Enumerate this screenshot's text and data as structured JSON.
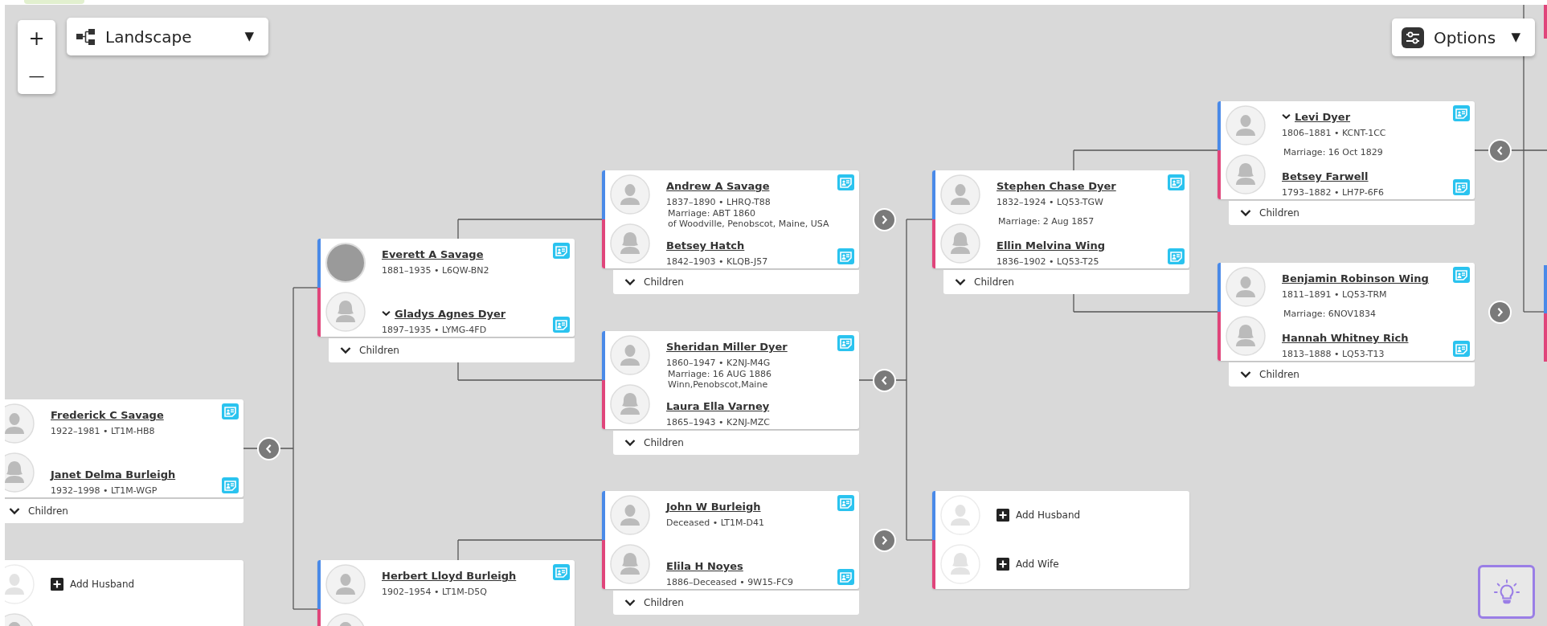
{
  "controls": {
    "zoom_in": "+",
    "zoom_out": "—",
    "layout_menu": {
      "label": "Landscape",
      "caret": "▼"
    },
    "options_menu": {
      "label": "Options",
      "caret": "▼"
    }
  },
  "couples": [
    {
      "husband": {
        "kind": "person",
        "name": "Frederick C Savage",
        "details": "1922–1981 • LT1M-HB8",
        "record": true,
        "toggle": false,
        "photo": false
      },
      "wife": {
        "kind": "person",
        "name": "Janet Delma Burleigh",
        "details": "1932–1998 • LT1M-WGP",
        "record": true,
        "toggle": false,
        "photo": false
      },
      "children_label": "Children",
      "ancestors_shown": true
    },
    {
      "husband": {
        "kind": "add",
        "label": "Add Husband"
      }
    },
    {
      "husband": {
        "kind": "person",
        "name": "Everett A Savage",
        "details": "1881–1935 • L6QW-BN2",
        "record": true,
        "toggle": false,
        "photo": true
      },
      "wife": {
        "kind": "person",
        "name": "Gladys Agnes Dyer",
        "details": "1897–1935 • LYMG-4FD",
        "record": true,
        "toggle": true,
        "photo": false
      },
      "children_label": "Children"
    },
    {
      "husband": {
        "kind": "person",
        "name": "Herbert Lloyd Burleigh",
        "details": "1902–1954 • LT1M-D5Q",
        "record": true,
        "toggle": false,
        "photo": false
      }
    },
    {
      "husband": {
        "kind": "person",
        "name": "Andrew A Savage",
        "details": "1837–1890 • LHRQ-T88",
        "record": true,
        "toggle": false,
        "photo": false
      },
      "wife": {
        "kind": "person",
        "name": "Betsey Hatch",
        "details": "1842–1903 • KLQB-J57",
        "record": true,
        "toggle": false,
        "photo": false
      },
      "marriage": [
        "Marriage: ABT 1860",
        "of Woodville, Penobscot, Maine, USA"
      ],
      "children_label": "Children",
      "ancestors_shown": false
    },
    {
      "husband": {
        "kind": "person",
        "name": "Sheridan Miller Dyer",
        "details": "1860–1947 • K2NJ-M4G",
        "record": true,
        "toggle": false,
        "photo": false
      },
      "wife": {
        "kind": "person",
        "name": "Laura Ella Varney",
        "details": "1865–1943 • K2NJ-MZC",
        "record": false,
        "toggle": false,
        "photo": false
      },
      "marriage": [
        "Marriage: 16 AUG 1886",
        "Winn,Penobscot,Maine"
      ],
      "children_label": "Children",
      "ancestors_shown": true
    },
    {
      "husband": {
        "kind": "person",
        "name": "John W Burleigh",
        "details": "Deceased • LT1M-D41",
        "record": true,
        "toggle": false,
        "photo": false
      },
      "wife": {
        "kind": "person",
        "name": "Elila H Noyes",
        "details": "1886–Deceased • 9W15-FC9",
        "record": true,
        "toggle": false,
        "photo": false
      },
      "children_label": "Children",
      "ancestors_shown": false
    },
    {
      "husband": {
        "kind": "person",
        "name": "Stephen Chase Dyer",
        "details": "1832–1924 • LQ53-TGW",
        "record": true,
        "toggle": false,
        "photo": false
      },
      "wife": {
        "kind": "person",
        "name": "Ellin Melvina Wing",
        "details": "1836–1902 • LQ53-T25",
        "record": true,
        "toggle": false,
        "photo": false
      },
      "marriage": [
        "Marriage: 2 Aug 1857"
      ],
      "children_label": "Children"
    },
    {
      "husband": {
        "kind": "add",
        "label": "Add Husband"
      },
      "wife": {
        "kind": "add",
        "label": "Add Wife"
      }
    },
    {
      "husband": {
        "kind": "person",
        "name": "Levi Dyer",
        "details": "1806–1881 • KCNT-1CC",
        "record": true,
        "toggle": true,
        "photo": false
      },
      "wife": {
        "kind": "person",
        "name": "Betsey Farwell",
        "details": "1793–1882 • LH7P-6F6",
        "record": true,
        "toggle": false,
        "photo": false
      },
      "marriage": [
        "Marriage: 16 Oct 1829"
      ],
      "children_label": "Children",
      "ancestors_shown": true
    },
    {
      "husband": {
        "kind": "person",
        "name": "Benjamin Robinson Wing",
        "details": "1811–1891 • LQ53-TRM",
        "record": true,
        "toggle": false,
        "photo": false
      },
      "wife": {
        "kind": "person",
        "name": "Hannah Whitney Rich",
        "details": "1813–1888 • LQ53-T13",
        "record": true,
        "toggle": false,
        "photo": false
      },
      "marriage": [
        "Marriage: 6NOV1834"
      ],
      "children_label": "Children",
      "ancestors_shown": false
    }
  ]
}
